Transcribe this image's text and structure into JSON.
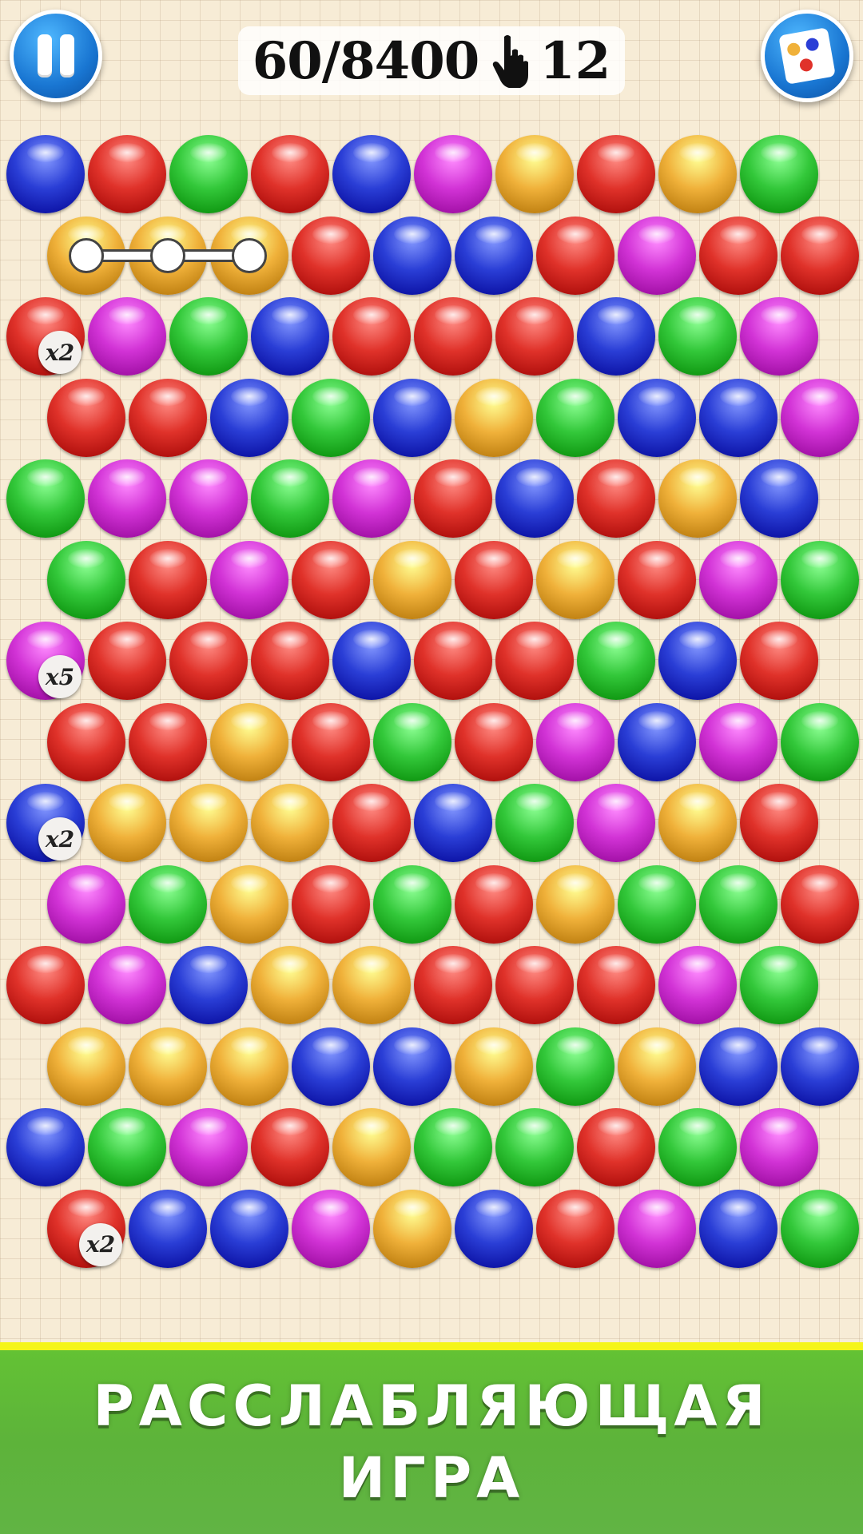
{
  "hud": {
    "score": "60/8400",
    "moves": "12",
    "pause_icon": "pause-icon",
    "cards_icon": "cards-icon",
    "hand_icon": "hand-tap-icon"
  },
  "colors": {
    "blue": "#2a3ed6",
    "red": "#e0322a",
    "green": "#33c83a",
    "magenta": "#d233d6",
    "orange": "#f0b13a"
  },
  "board": {
    "rows": [
      [
        "blue",
        "red",
        "green",
        "red",
        "blue",
        "magenta",
        "orange",
        "red",
        "orange",
        "green"
      ],
      [
        "orange",
        "orange",
        "orange",
        "red",
        "blue",
        "blue",
        "red",
        "magenta",
        "red",
        "red"
      ],
      [
        "red",
        "magenta",
        "green",
        "blue",
        "red",
        "red",
        "red",
        "blue",
        "green",
        "magenta"
      ],
      [
        "red",
        "red",
        "blue",
        "green",
        "blue",
        "orange",
        "green",
        "blue",
        "blue",
        "magenta"
      ],
      [
        "green",
        "magenta",
        "magenta",
        "green",
        "magenta",
        "red",
        "blue",
        "red",
        "orange",
        "blue"
      ],
      [
        "green",
        "red",
        "magenta",
        "red",
        "orange",
        "red",
        "orange",
        "red",
        "magenta",
        "green"
      ],
      [
        "magenta",
        "red",
        "red",
        "red",
        "blue",
        "red",
        "red",
        "green",
        "blue",
        "red"
      ],
      [
        "red",
        "red",
        "orange",
        "red",
        "green",
        "red",
        "magenta",
        "blue",
        "magenta",
        "green"
      ],
      [
        "blue",
        "orange",
        "orange",
        "orange",
        "red",
        "blue",
        "green",
        "magenta",
        "orange",
        "red"
      ],
      [
        "magenta",
        "green",
        "orange",
        "red",
        "green",
        "red",
        "orange",
        "green",
        "green",
        "red"
      ],
      [
        "red",
        "magenta",
        "blue",
        "orange",
        "orange",
        "red",
        "red",
        "red",
        "magenta",
        "green"
      ],
      [
        "orange",
        "orange",
        "orange",
        "blue",
        "blue",
        "orange",
        "green",
        "orange",
        "blue",
        "blue"
      ],
      [
        "blue",
        "green",
        "magenta",
        "red",
        "orange",
        "green",
        "green",
        "red",
        "green",
        "magenta"
      ],
      [
        "red",
        "blue",
        "blue",
        "magenta",
        "orange",
        "blue",
        "red",
        "magenta",
        "blue",
        "green"
      ]
    ],
    "multipliers": [
      {
        "row": 2,
        "col": 0,
        "label": "x2"
      },
      {
        "row": 6,
        "col": 0,
        "label": "x5"
      },
      {
        "row": 8,
        "col": 0,
        "label": "x2"
      },
      {
        "row": 13,
        "col": 0,
        "label": "x2"
      }
    ],
    "chain": {
      "row": 1,
      "cols": [
        0,
        1,
        2
      ]
    }
  },
  "banner": {
    "line1": "РАССЛАБЛЯЮЩАЯ",
    "line2": "ИГРА",
    "accent": "#f5f51a",
    "background": "#5db33a"
  }
}
